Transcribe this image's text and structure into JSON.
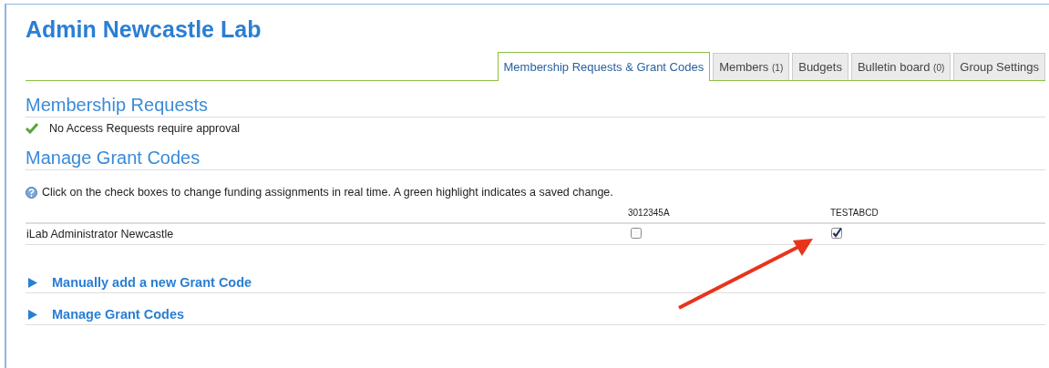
{
  "title": "Admin Newcastle Lab",
  "tabs": [
    {
      "label": "Membership Requests & Grant Codes",
      "selected": true
    },
    {
      "label": "Members",
      "count": "(1)",
      "selected": false
    },
    {
      "label": "Budgets",
      "selected": false
    },
    {
      "label": "Bulletin board",
      "count": "(0)",
      "selected": false
    },
    {
      "label": "Group Settings",
      "selected": false
    }
  ],
  "membership_requests": {
    "heading": "Membership Requests",
    "message": "No Access Requests require approval"
  },
  "grant_codes": {
    "heading": "Manage Grant Codes",
    "info": "Click on the check boxes to change funding assignments in real time. A green highlight indicates a saved change.",
    "columns": [
      "3012345A",
      "TESTABCD"
    ],
    "rows": [
      {
        "name": "iLab Administrator Newcastle",
        "cells": [
          {
            "checked": false
          },
          {
            "checked": true
          }
        ]
      }
    ]
  },
  "panels": [
    {
      "label": "Manually add a new Grant Code",
      "expanded": false
    },
    {
      "label": "Manage Grant Codes",
      "expanded": false
    }
  ]
}
